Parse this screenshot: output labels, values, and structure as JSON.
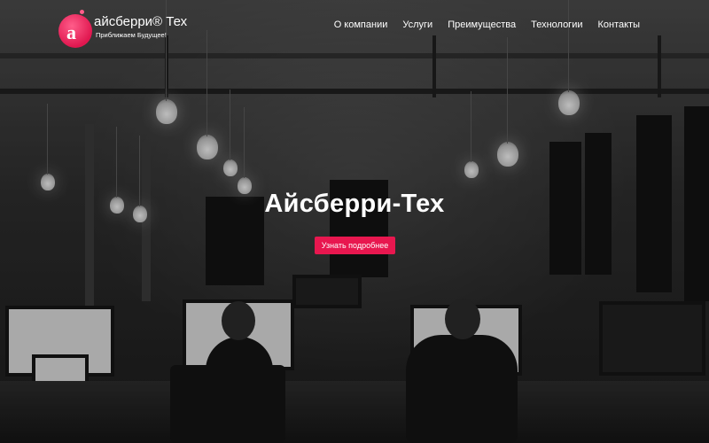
{
  "header": {
    "logo": {
      "letter": "а",
      "name": "айсберри® Тех",
      "tagline": "Приближаем Будущее!"
    },
    "nav": [
      {
        "label": "О компании"
      },
      {
        "label": "Услуги"
      },
      {
        "label": "Преимущества"
      },
      {
        "label": "Технологии"
      },
      {
        "label": "Контакты"
      }
    ]
  },
  "hero": {
    "title": "Айсберри-Тех",
    "cta_label": "Узнать подробнее",
    "accent_color": "#e8174f",
    "background": "grayscale office photo with hanging light bulbs and desks with monitors"
  }
}
